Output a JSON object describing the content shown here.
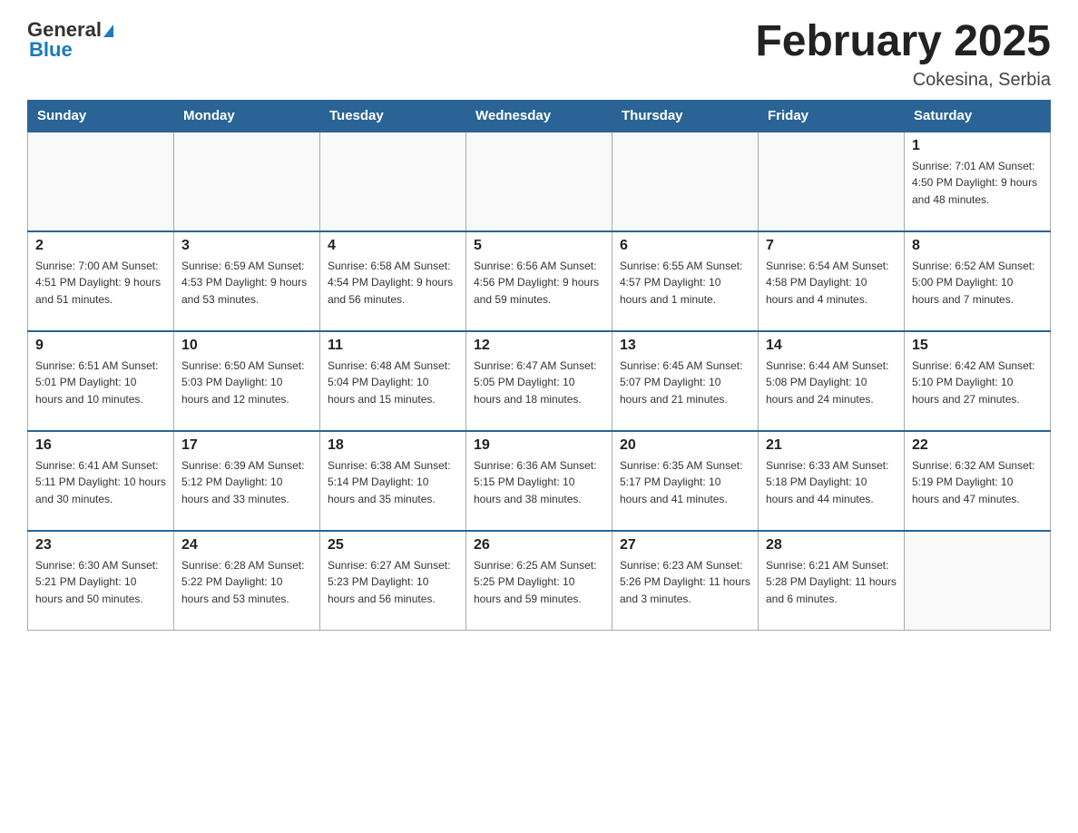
{
  "header": {
    "logo_general": "General",
    "logo_blue": "Blue",
    "month_title": "February 2025",
    "location": "Cokesina, Serbia"
  },
  "weekdays": [
    "Sunday",
    "Monday",
    "Tuesday",
    "Wednesday",
    "Thursday",
    "Friday",
    "Saturday"
  ],
  "weeks": [
    [
      {
        "day": "",
        "info": ""
      },
      {
        "day": "",
        "info": ""
      },
      {
        "day": "",
        "info": ""
      },
      {
        "day": "",
        "info": ""
      },
      {
        "day": "",
        "info": ""
      },
      {
        "day": "",
        "info": ""
      },
      {
        "day": "1",
        "info": "Sunrise: 7:01 AM\nSunset: 4:50 PM\nDaylight: 9 hours\nand 48 minutes."
      }
    ],
    [
      {
        "day": "2",
        "info": "Sunrise: 7:00 AM\nSunset: 4:51 PM\nDaylight: 9 hours\nand 51 minutes."
      },
      {
        "day": "3",
        "info": "Sunrise: 6:59 AM\nSunset: 4:53 PM\nDaylight: 9 hours\nand 53 minutes."
      },
      {
        "day": "4",
        "info": "Sunrise: 6:58 AM\nSunset: 4:54 PM\nDaylight: 9 hours\nand 56 minutes."
      },
      {
        "day": "5",
        "info": "Sunrise: 6:56 AM\nSunset: 4:56 PM\nDaylight: 9 hours\nand 59 minutes."
      },
      {
        "day": "6",
        "info": "Sunrise: 6:55 AM\nSunset: 4:57 PM\nDaylight: 10 hours\nand 1 minute."
      },
      {
        "day": "7",
        "info": "Sunrise: 6:54 AM\nSunset: 4:58 PM\nDaylight: 10 hours\nand 4 minutes."
      },
      {
        "day": "8",
        "info": "Sunrise: 6:52 AM\nSunset: 5:00 PM\nDaylight: 10 hours\nand 7 minutes."
      }
    ],
    [
      {
        "day": "9",
        "info": "Sunrise: 6:51 AM\nSunset: 5:01 PM\nDaylight: 10 hours\nand 10 minutes."
      },
      {
        "day": "10",
        "info": "Sunrise: 6:50 AM\nSunset: 5:03 PM\nDaylight: 10 hours\nand 12 minutes."
      },
      {
        "day": "11",
        "info": "Sunrise: 6:48 AM\nSunset: 5:04 PM\nDaylight: 10 hours\nand 15 minutes."
      },
      {
        "day": "12",
        "info": "Sunrise: 6:47 AM\nSunset: 5:05 PM\nDaylight: 10 hours\nand 18 minutes."
      },
      {
        "day": "13",
        "info": "Sunrise: 6:45 AM\nSunset: 5:07 PM\nDaylight: 10 hours\nand 21 minutes."
      },
      {
        "day": "14",
        "info": "Sunrise: 6:44 AM\nSunset: 5:08 PM\nDaylight: 10 hours\nand 24 minutes."
      },
      {
        "day": "15",
        "info": "Sunrise: 6:42 AM\nSunset: 5:10 PM\nDaylight: 10 hours\nand 27 minutes."
      }
    ],
    [
      {
        "day": "16",
        "info": "Sunrise: 6:41 AM\nSunset: 5:11 PM\nDaylight: 10 hours\nand 30 minutes."
      },
      {
        "day": "17",
        "info": "Sunrise: 6:39 AM\nSunset: 5:12 PM\nDaylight: 10 hours\nand 33 minutes."
      },
      {
        "day": "18",
        "info": "Sunrise: 6:38 AM\nSunset: 5:14 PM\nDaylight: 10 hours\nand 35 minutes."
      },
      {
        "day": "19",
        "info": "Sunrise: 6:36 AM\nSunset: 5:15 PM\nDaylight: 10 hours\nand 38 minutes."
      },
      {
        "day": "20",
        "info": "Sunrise: 6:35 AM\nSunset: 5:17 PM\nDaylight: 10 hours\nand 41 minutes."
      },
      {
        "day": "21",
        "info": "Sunrise: 6:33 AM\nSunset: 5:18 PM\nDaylight: 10 hours\nand 44 minutes."
      },
      {
        "day": "22",
        "info": "Sunrise: 6:32 AM\nSunset: 5:19 PM\nDaylight: 10 hours\nand 47 minutes."
      }
    ],
    [
      {
        "day": "23",
        "info": "Sunrise: 6:30 AM\nSunset: 5:21 PM\nDaylight: 10 hours\nand 50 minutes."
      },
      {
        "day": "24",
        "info": "Sunrise: 6:28 AM\nSunset: 5:22 PM\nDaylight: 10 hours\nand 53 minutes."
      },
      {
        "day": "25",
        "info": "Sunrise: 6:27 AM\nSunset: 5:23 PM\nDaylight: 10 hours\nand 56 minutes."
      },
      {
        "day": "26",
        "info": "Sunrise: 6:25 AM\nSunset: 5:25 PM\nDaylight: 10 hours\nand 59 minutes."
      },
      {
        "day": "27",
        "info": "Sunrise: 6:23 AM\nSunset: 5:26 PM\nDaylight: 11 hours\nand 3 minutes."
      },
      {
        "day": "28",
        "info": "Sunrise: 6:21 AM\nSunset: 5:28 PM\nDaylight: 11 hours\nand 6 minutes."
      },
      {
        "day": "",
        "info": ""
      }
    ]
  ]
}
